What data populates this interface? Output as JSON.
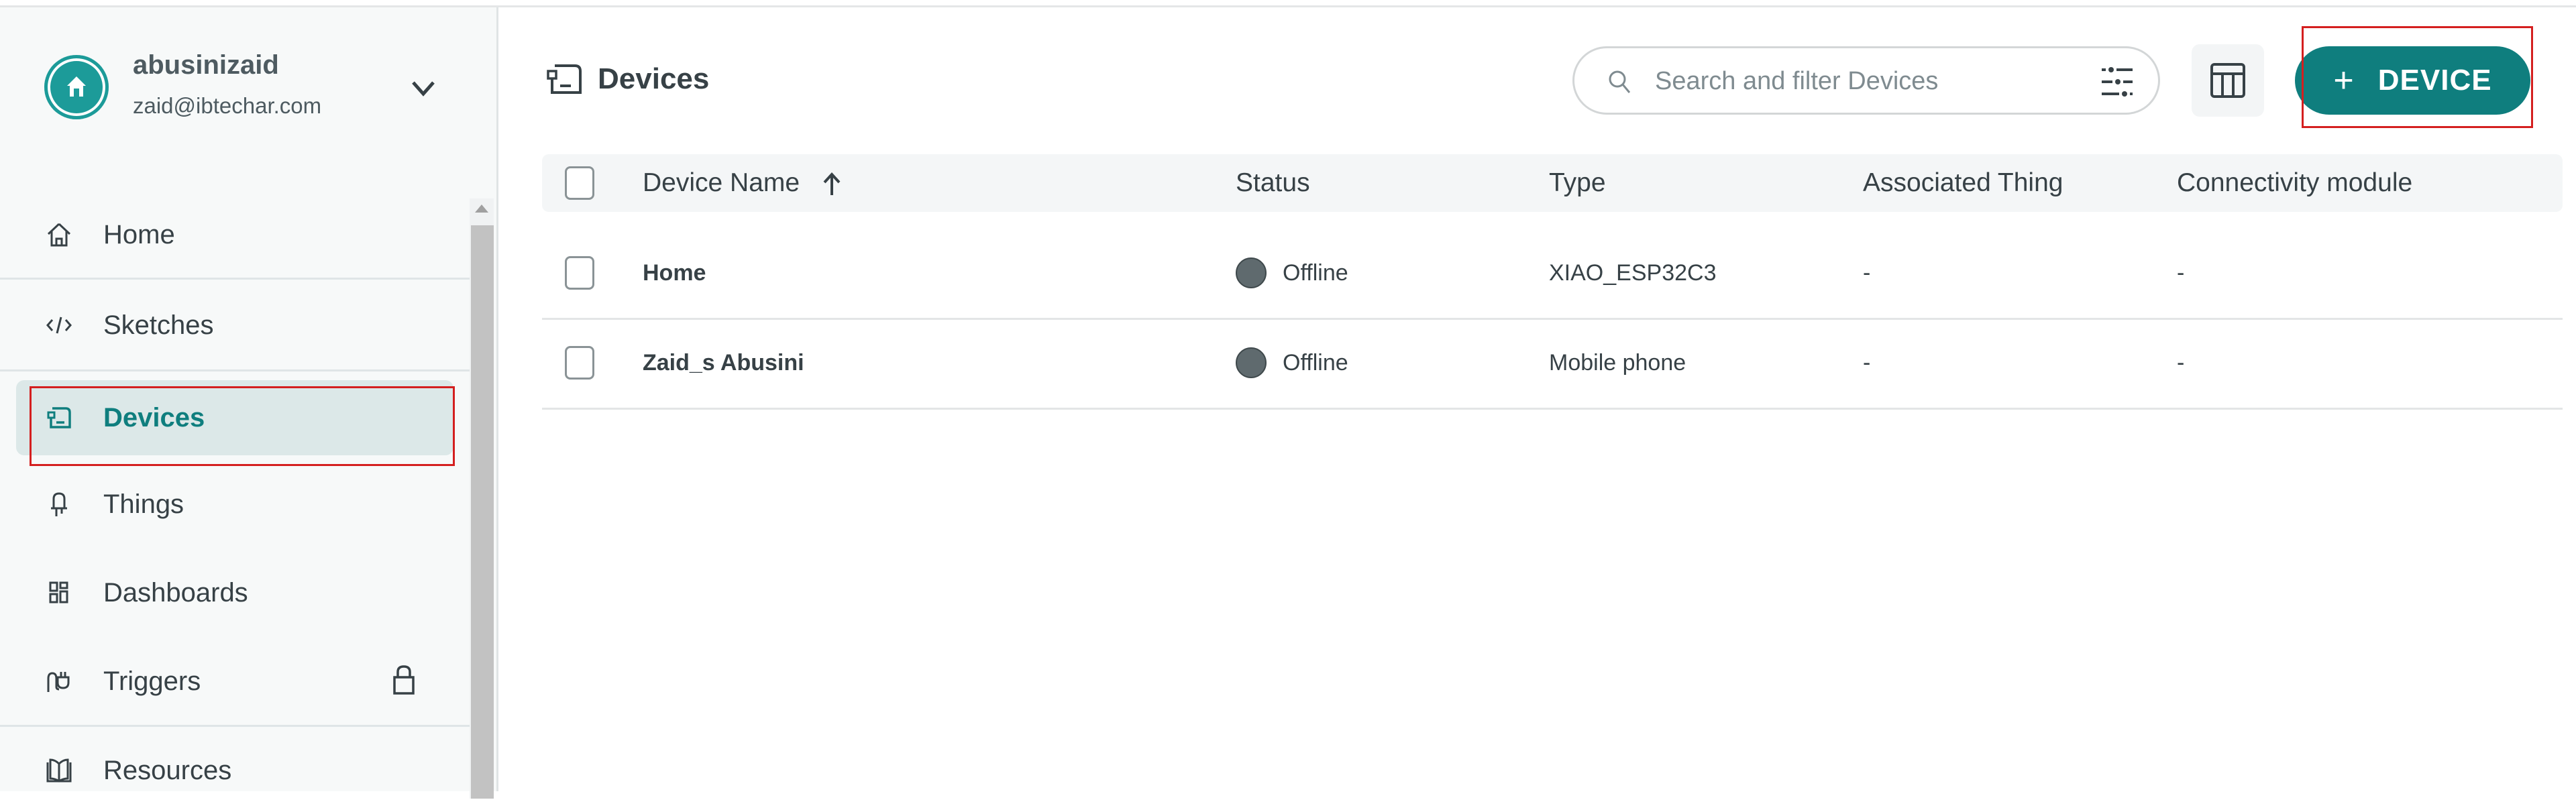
{
  "account": {
    "username": "abusinizaid",
    "email": "zaid@ibtechar.com"
  },
  "sidebar": {
    "items": [
      {
        "label": "Home",
        "icon": "home-icon"
      },
      {
        "label": "Sketches",
        "icon": "code-icon"
      },
      {
        "label": "Devices",
        "icon": "device-icon",
        "active": true
      },
      {
        "label": "Things",
        "icon": "led-icon"
      },
      {
        "label": "Dashboards",
        "icon": "dashboard-icon"
      },
      {
        "label": "Triggers",
        "icon": "plug-icon",
        "locked": true
      },
      {
        "label": "Resources",
        "icon": "book-icon"
      }
    ]
  },
  "header": {
    "title": "Devices",
    "search_placeholder": "Search and filter Devices",
    "search_value": "",
    "add_button_label": "DEVICE"
  },
  "table": {
    "columns": [
      "Device Name",
      "Status",
      "Type",
      "Associated Thing",
      "Connectivity module"
    ],
    "sort": {
      "column": "Device Name",
      "direction": "ascending"
    },
    "rows": [
      {
        "name": "Home",
        "status": "Offline",
        "type": "XIAO_ESP32C3",
        "associated_thing": "-",
        "connectivity_module": "-"
      },
      {
        "name": "Zaid_s Abusini",
        "status": "Offline",
        "type": "Mobile phone",
        "associated_thing": "-",
        "connectivity_module": "-"
      }
    ]
  },
  "colors": {
    "accent": "#0f7e7e",
    "avatar": "#1c9b99",
    "active_nav_bg": "#dce8e8",
    "offline_dot": "#5f6a6e",
    "annotation_box": "#d41f1f"
  }
}
